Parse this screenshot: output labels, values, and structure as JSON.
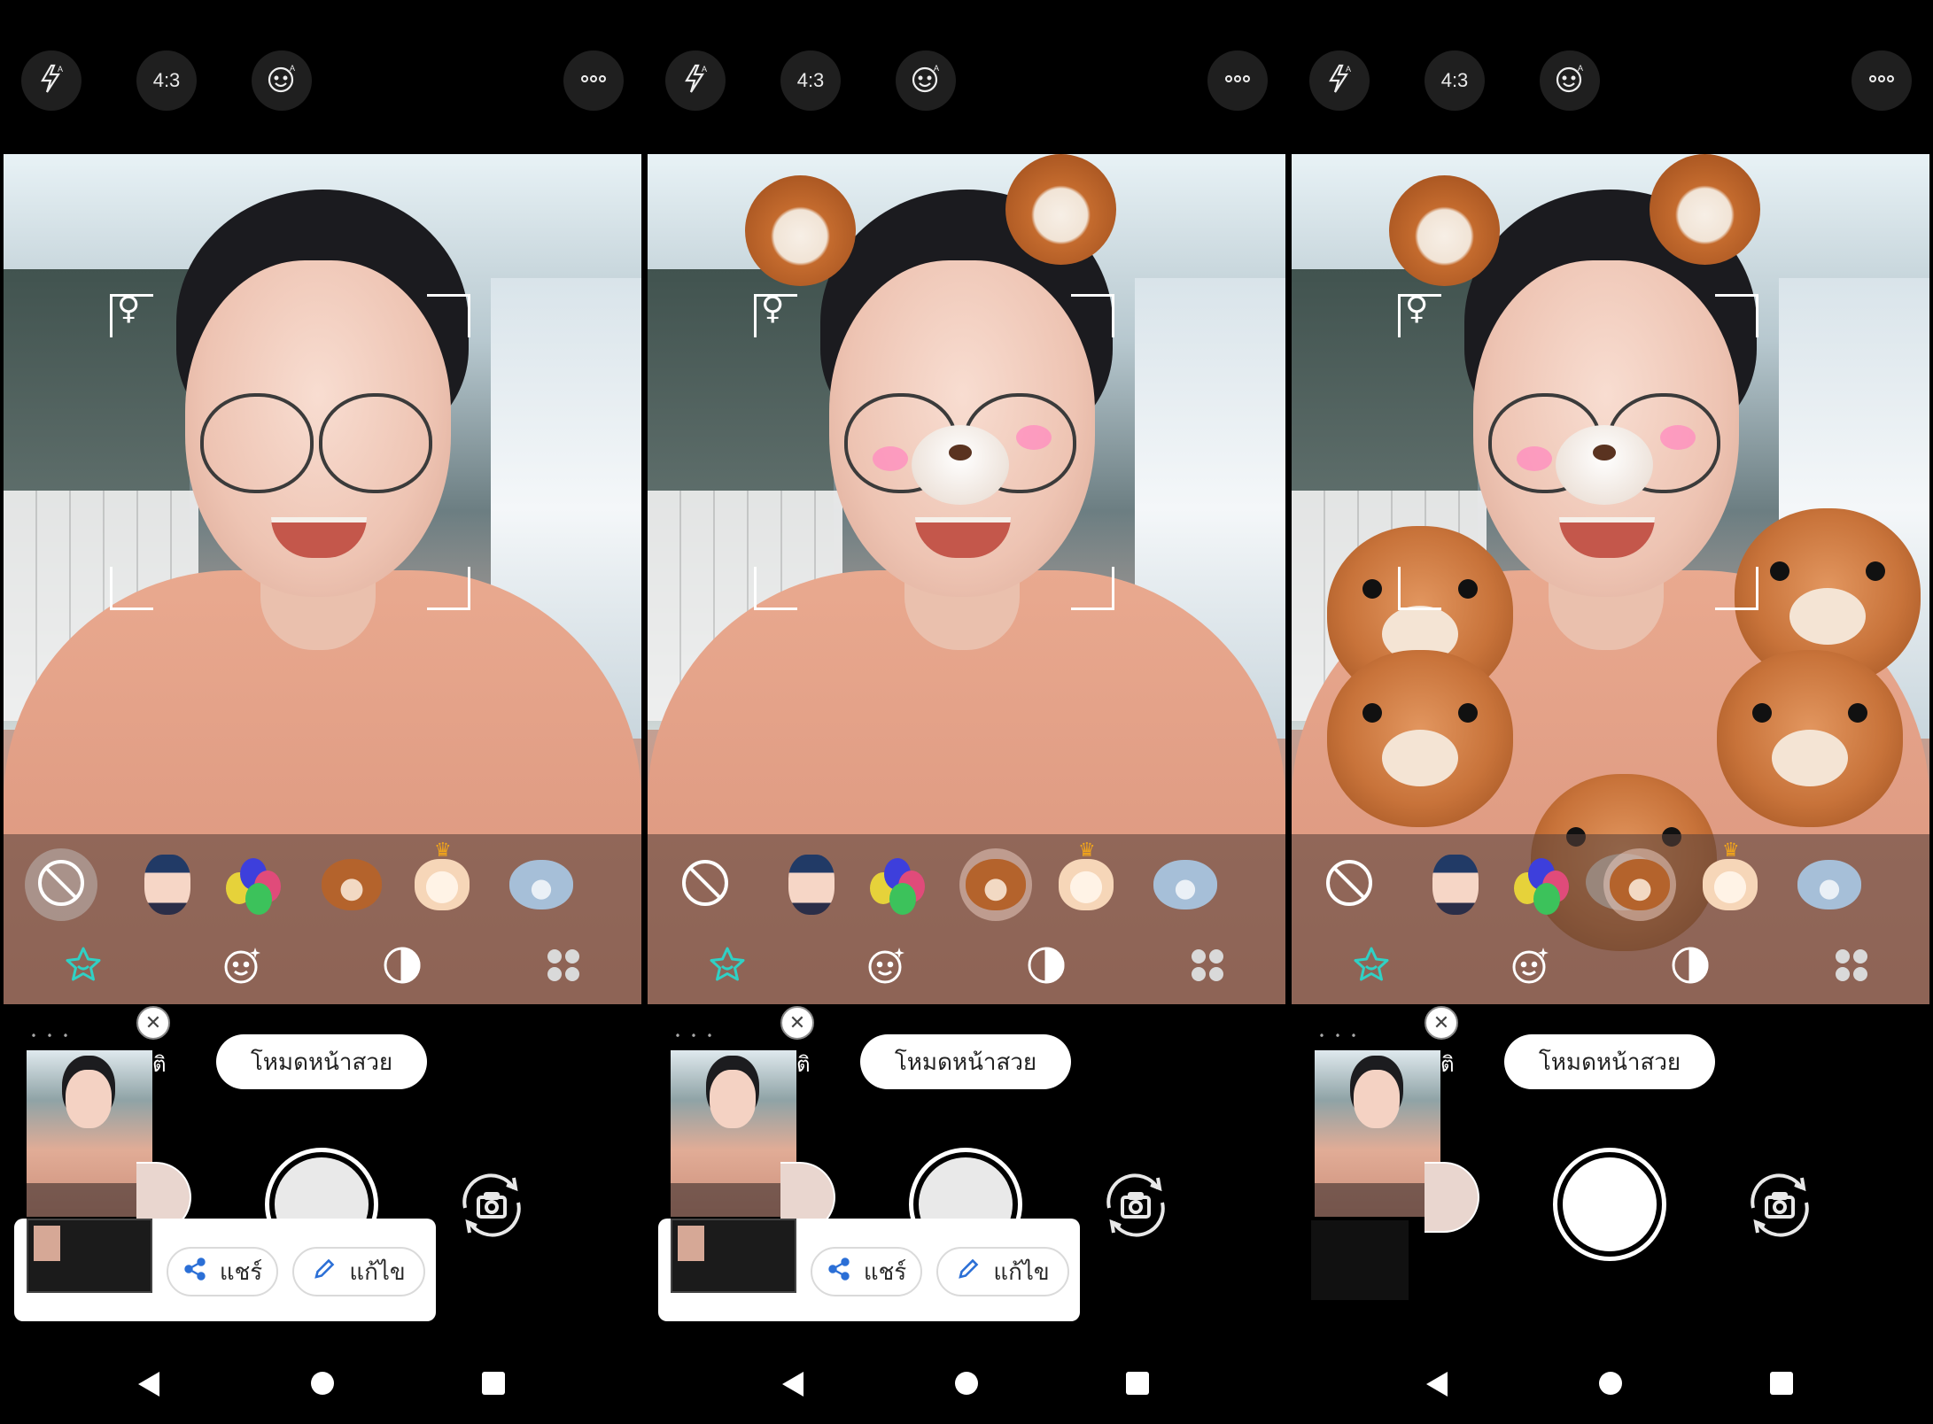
{
  "top_bar": {
    "flash_icon": "flash-auto-icon",
    "ratio_label": "4:3",
    "face_auto_icon": "face-auto-icon",
    "more_icon": "more-horizontal-icon"
  },
  "stickers": [
    "none",
    "doll",
    "balloons",
    "bear",
    "cat-king",
    "blue-bear"
  ],
  "modes": [
    "sticker-star",
    "face-sparkle",
    "filter-contrast",
    "grid-more"
  ],
  "bottom": {
    "close_label": "✕",
    "beauty_mode_label": "โหมดหน้าสวย",
    "truncated_text": "ติ",
    "share_label": "แชร์",
    "edit_label": "แก้ไข"
  },
  "panels": [
    {
      "id": "panel-1",
      "selected_sticker": "none",
      "effect": "none",
      "share_sheet": true
    },
    {
      "id": "panel-2",
      "selected_sticker": "bear",
      "effect": "bear-ears",
      "share_sheet": true
    },
    {
      "id": "panel-3",
      "selected_sticker": "bear",
      "effect": "bear-ears-with-teddies",
      "share_sheet": false
    }
  ],
  "colors": {
    "accent": "#2fd1c5",
    "background": "#000000",
    "tray": "rgba(88,66,58,0.58)"
  }
}
